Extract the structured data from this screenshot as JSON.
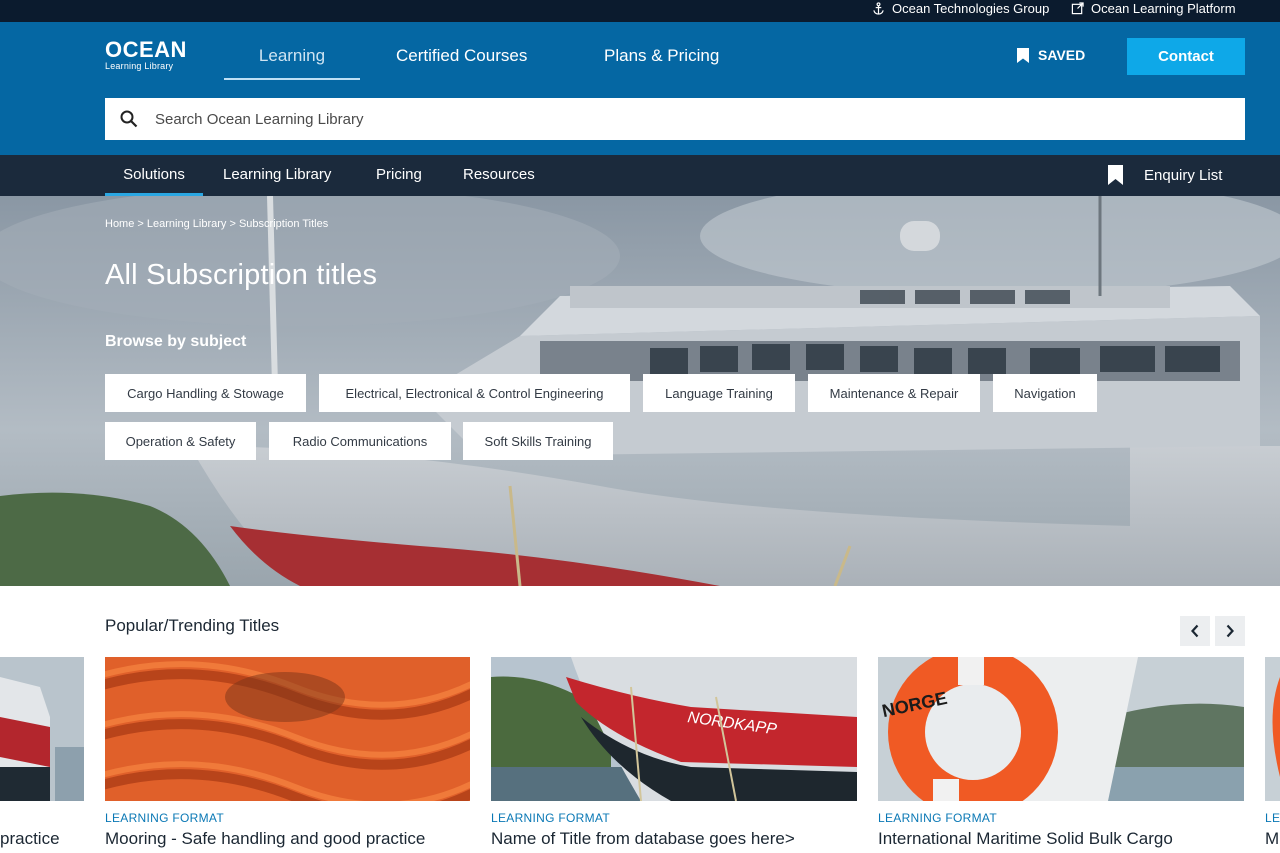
{
  "utility": {
    "link1": "Ocean Technologies Group",
    "link2": "Ocean Learning Platform"
  },
  "header": {
    "logo_main": "OCEAN",
    "logo_sub": "Learning Library",
    "nav": [
      "Learning",
      "Certified Courses",
      "Plans & Pricing"
    ],
    "saved": "SAVED",
    "contact": "Contact",
    "search_placeholder": "Search Ocean Learning Library"
  },
  "subnav": {
    "items": [
      "Solutions",
      "Learning Library",
      "Pricing",
      "Resources"
    ],
    "enquiry": "Enquiry List"
  },
  "hero": {
    "breadcrumb": [
      "Home",
      "Learning Library",
      "Subscription Titles"
    ],
    "breadcrumb_sep": ">",
    "title": "All Subscription titles",
    "browse_heading": "Browse by subject",
    "subjects": [
      "Cargo Handling & Stowage",
      "Electrical, Electronical & Control Engineering",
      "Language Training",
      "Maintenance & Repair",
      "Navigation",
      "Operation & Safety",
      "Radio Communications",
      "Soft Skills Training"
    ]
  },
  "popular": {
    "title": "Popular/Trending Titles",
    "cards": [
      {
        "format": "",
        "title": "practice"
      },
      {
        "format": "LEARNING FORMAT",
        "title": "Mooring - Safe handling and good practice"
      },
      {
        "format": "LEARNING FORMAT",
        "title": "Name of Title from database goes here>"
      },
      {
        "format": "LEARNING FORMAT",
        "title": "International Maritime Solid Bulk Cargo"
      },
      {
        "format": "LE",
        "title": "M"
      }
    ],
    "ship_name": "NORDKAPP",
    "ring_text": "NORGE"
  },
  "colors": {
    "header_blue": "#0567a3",
    "subnav_dark": "#1b2a3c",
    "contact_blue": "#0ea8e8",
    "format_blue": "#0a78b5"
  }
}
